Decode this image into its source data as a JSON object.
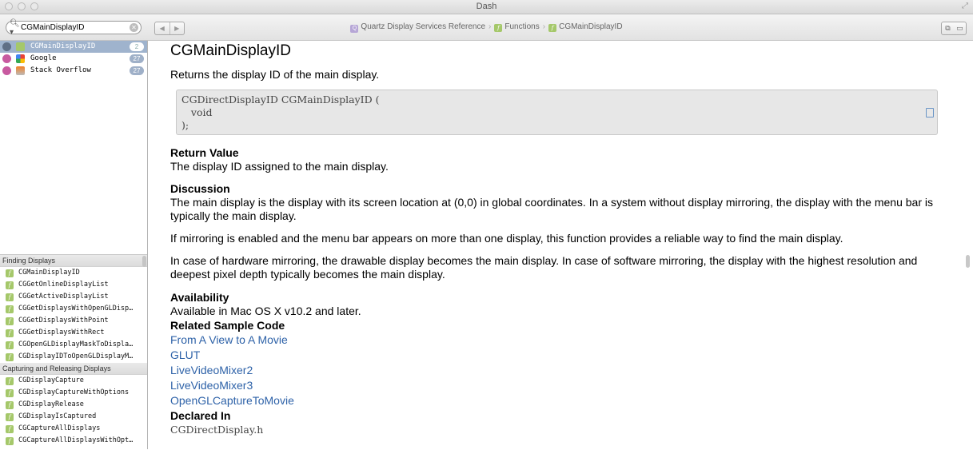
{
  "window": {
    "title": "Dash"
  },
  "search": {
    "value": "CGMainDisplayID"
  },
  "breadcrumb": {
    "items": [
      "Quartz Display Services Reference",
      "Functions",
      "CGMainDisplayID"
    ]
  },
  "results": [
    {
      "label": "CGMainDisplayID",
      "count": "2"
    },
    {
      "label": "Google",
      "count": "27"
    },
    {
      "label": "Stack Overflow",
      "count": "27"
    }
  ],
  "toc": {
    "section1": "Finding Displays",
    "items1": [
      "CGMainDisplayID",
      "CGGetOnlineDisplayList",
      "CGGetActiveDisplayList",
      "CGGetDisplaysWithOpenGLDisp…",
      "CGGetDisplaysWithPoint",
      "CGGetDisplaysWithRect",
      "CGOpenGLDisplayMaskToDispla…",
      "CGDisplayIDToOpenGLDisplayM…"
    ],
    "section2": "Capturing and Releasing Displays",
    "items2": [
      "CGDisplayCapture",
      "CGDisplayCaptureWithOptions",
      "CGDisplayRelease",
      "CGDisplayIsCaptured",
      "CGCaptureAllDisplays",
      "CGCaptureAllDisplaysWithOpt…"
    ]
  },
  "doc": {
    "title": "CGMainDisplayID",
    "abstract": "Returns the display ID of the main display.",
    "code": "CGDirectDisplayID CGMainDisplayID (\n   void\n);",
    "return_heading": "Return Value",
    "return_text": "The display ID assigned to the main display.",
    "discussion_heading": "Discussion",
    "discussion_p1": "The main display is the display with its screen location at (0,0) in global coordinates. In a system without display mirroring, the display with the menu bar is typically the main display.",
    "discussion_p2": "If mirroring is enabled and the menu bar appears on more than one display, this function provides a reliable way to find the main display.",
    "discussion_p3": "In case of hardware mirroring, the drawable display becomes the main display. In case of software mirroring, the display with the highest resolution and deepest pixel depth typically becomes the main display.",
    "availability_heading": "Availability",
    "availability_text": "Available in Mac OS X v10.2 and later.",
    "sample_heading": "Related Sample Code",
    "sample_links": [
      "From A View to A Movie",
      "GLUT",
      "LiveVideoMixer2",
      "LiveVideoMixer3",
      "OpenGLCaptureToMovie"
    ],
    "declared_heading": "Declared In",
    "declared_text": "CGDirectDisplay.h"
  },
  "colors": {
    "link": "#2e62a8",
    "selection": "#9fb3cd",
    "function_badge": "#a5c86a"
  },
  "icons": [
    "search-icon",
    "clear-icon",
    "back-icon",
    "forward-icon",
    "open-in-browser-icon",
    "bookmark-icon",
    "copy-icon"
  ]
}
